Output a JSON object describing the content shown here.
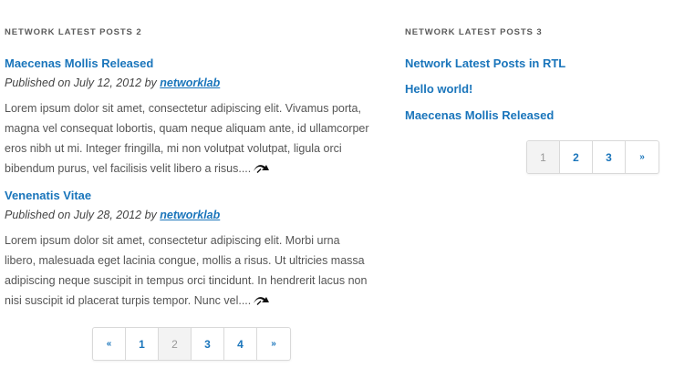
{
  "left_widget": {
    "title": "NETWORK LATEST POSTS 2",
    "posts": [
      {
        "title": "Maecenas Mollis Released",
        "meta_prefix": "Published on July 12, 2012 by ",
        "author": "networklab",
        "excerpt_lines": [
          "Lorem ipsum dolor sit amet, consectetur adipiscing elit. Vivamus porta,",
          "magna vel consequat lobortis, quam neque aliquam ante, id ullamcorper",
          "eros nibh ut mi. Integer fringilla, mi non volutpat volutpat, ligula orci",
          "bibendum purus, vel facilisis velit libero a risus...."
        ]
      },
      {
        "title": "Venenatis Vitae",
        "meta_prefix": "Published on July 28, 2012 by ",
        "author": "networklab",
        "excerpt_lines": [
          "Lorem ipsum dolor sit amet, consectetur adipiscing elit. Morbi urna",
          "libero, malesuada eget lacinia congue, mollis a risus. Ut ultricies massa",
          "adipiscing neque suscipit in tempus orci tincidunt. In hendrerit lacus non",
          "nisi suscipit id placerat turpis tempor. Nunc vel...."
        ]
      }
    ],
    "pagination": {
      "prev": "«",
      "pages": [
        "1",
        "2",
        "3",
        "4"
      ],
      "current": "2",
      "next": "»"
    }
  },
  "right_widget": {
    "title": "NETWORK LATEST POSTS 3",
    "links": [
      "Network Latest Posts in RTL",
      "Hello world!",
      "Maecenas Mollis Released"
    ],
    "pagination": {
      "pages": [
        "1",
        "2",
        "3"
      ],
      "current": "1",
      "next": "»"
    }
  },
  "icons": {
    "read_more": "read-more-arrow-icon"
  },
  "colors": {
    "link": "#1a75bb",
    "text": "#555555",
    "heading": "#5b5b5b",
    "current_page_bg": "#f3f3f3"
  }
}
